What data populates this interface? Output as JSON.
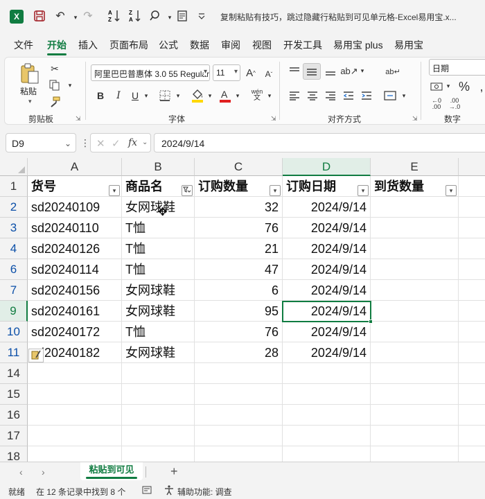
{
  "window": {
    "title": "复制粘贴有技巧，跳过隐藏行粘贴到可见单元格-Excel易用宝.x..."
  },
  "quick_access": {
    "excel_logo": "X",
    "save_icon": "save-icon",
    "undo_icon": "undo-icon",
    "redo_icon": "redo-icon",
    "sort_asc": "A↓Z",
    "sort_desc": "Z↓A"
  },
  "menu": {
    "tabs": [
      "文件",
      "开始",
      "插入",
      "页面布局",
      "公式",
      "数据",
      "审阅",
      "视图",
      "开发工具",
      "易用宝 plus",
      "易用宝"
    ],
    "active": "开始"
  },
  "ribbon": {
    "clipboard": {
      "paste_label": "粘贴",
      "group_label": "剪贴板"
    },
    "font": {
      "font_name": "阿里巴巴普惠体 3.0 55 Regular",
      "font_size": "11",
      "group_label": "字体",
      "phonetic": "wén"
    },
    "alignment": {
      "group_label": "对齐方式"
    },
    "number": {
      "format": "日期",
      "group_label": "数字"
    }
  },
  "formula_bar": {
    "name_box": "D9",
    "formula": "2024/9/14",
    "fx": "fx"
  },
  "sheet": {
    "columns": [
      "A",
      "B",
      "C",
      "D",
      "E"
    ],
    "selected_column": "D",
    "header_row_number": "1",
    "headers": [
      "货号",
      "商品名",
      "订购数量",
      "订购日期",
      "到货数量"
    ],
    "rows": [
      {
        "row": "2",
        "values": [
          "sd20240109",
          "女网球鞋",
          "32",
          "2024/9/14",
          ""
        ]
      },
      {
        "row": "3",
        "values": [
          "sd20240110",
          "T恤",
          "76",
          "2024/9/14",
          ""
        ]
      },
      {
        "row": "4",
        "values": [
          "sd20240126",
          "T恤",
          "21",
          "2024/9/14",
          ""
        ]
      },
      {
        "row": "6",
        "values": [
          "sd20240114",
          "T恤",
          "47",
          "2024/9/14",
          ""
        ]
      },
      {
        "row": "7",
        "values": [
          "sd20240156",
          "女网球鞋",
          "6",
          "2024/9/14",
          ""
        ]
      },
      {
        "row": "9",
        "values": [
          "sd20240161",
          "女网球鞋",
          "95",
          "2024/9/14",
          ""
        ]
      },
      {
        "row": "10",
        "values": [
          "sd20240172",
          "T恤",
          "76",
          "2024/9/14",
          ""
        ]
      },
      {
        "row": "11",
        "values": [
          "sd20240182",
          "女网球鞋",
          "28",
          "2024/9/14",
          ""
        ]
      }
    ],
    "empty_rows": [
      "14",
      "15",
      "16",
      "17",
      "18"
    ],
    "selected_cell": "D9"
  },
  "sheet_tabs": {
    "tabs": [
      "粘贴到可见"
    ],
    "add": "+",
    "prev": "‹",
    "next": "›"
  },
  "status_bar": {
    "ready": "就绪",
    "filter_info": "在 12 条记录中找到 8 个",
    "accessibility": "辅助功能: 调查"
  }
}
